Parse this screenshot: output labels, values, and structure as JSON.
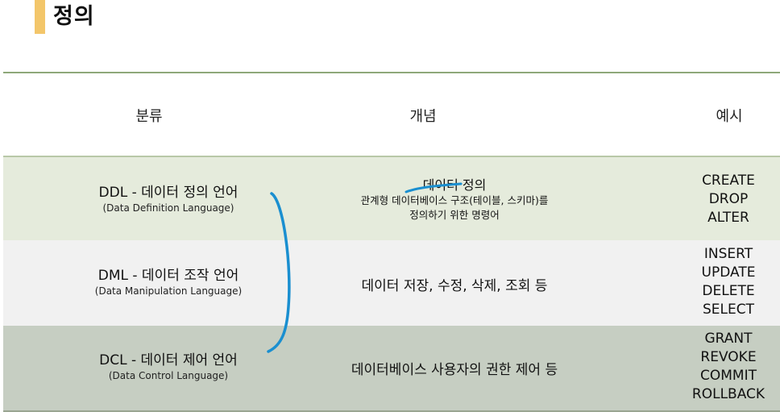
{
  "title": "정의",
  "headers": {
    "category": "분류",
    "concept": "개념",
    "examples": "예시"
  },
  "rows": [
    {
      "name": "DDL - 데이터 정의 언어",
      "full": "(Data Definition Language)",
      "concept_title": "데이터 정의",
      "concept_lines": [
        "관계형 데이터베이스 구조(테이블, 스키마)를",
        "정의하기 위한 명령어"
      ],
      "examples": [
        "CREATE",
        "DROP",
        "ALTER"
      ]
    },
    {
      "name": "DML - 데이터 조작 언어",
      "full": "(Data Manipulation Language)",
      "concept": "데이터 저장, 수정, 삭제, 조회 등",
      "examples": [
        "INSERT",
        "UPDATE",
        "DELETE",
        "SELECT"
      ]
    },
    {
      "name": "DCL - 데이터 제어 언어",
      "full": "(Data Control Language)",
      "concept": "데이터베이스 사용자의 권한 제어 등",
      "examples": [
        "GRANT",
        "REVOKE",
        "COMMIT",
        "ROLLBACK"
      ]
    }
  ],
  "colors": {
    "accent": "#f3c66a",
    "row1": "#e5ebdc",
    "row2": "#f1f1f1",
    "row3": "#c6cec2",
    "ink": "#1a8fd0"
  }
}
